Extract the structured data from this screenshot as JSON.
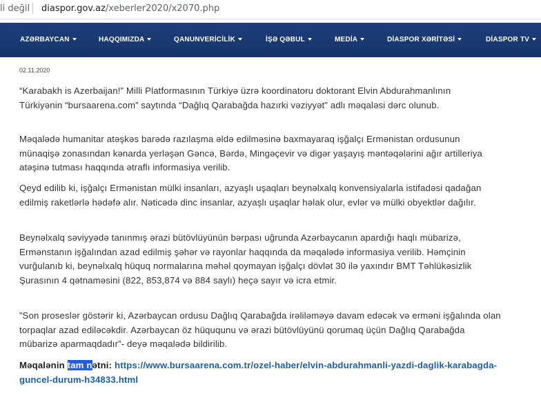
{
  "browser": {
    "security_text": "li değil",
    "url_domain": "diaspor.gov.az",
    "url_path": "/xeberler2020/x2070.php"
  },
  "nav": {
    "items": [
      {
        "label": "AZƏRBAYCAN"
      },
      {
        "label": "HAQQIMIZDA"
      },
      {
        "label": "QANUNVERİCİLİK"
      },
      {
        "label": "İŞƏ QƏBUL"
      },
      {
        "label": "MEDİA"
      },
      {
        "label": "DİASPOR XƏRİTƏSİ"
      },
      {
        "label": "DİASPOR TV"
      }
    ]
  },
  "article": {
    "date": "02.11.2020",
    "paragraphs": [
      "“Karabakh is Azerbaijan!” Milli Platformasının Türkiyə üzrə koordinatoru doktorant Elvin Abdurahmanlının Türkiyənin “bursaarena.com” saytında “Dağlıq Qarabağda hazırki vəziyyət” adlı məqaləsi dərc olunub.",
      "Məqalədə humanitar atəşkəs barədə razılaşma əldə edilməsinə baxmayaraq işğalçı Ermənistan ordusunun münaqişə zonasından kənarda yerləşən Gəncə, Bərdə, Mingəçevir və digər yaşayış məntəqələrini ağır artilleriya atəşinə tutması haqqında ətraflı informasiya verilib.",
      "Qeyd edilib ki, işğalçı Ermənistan mülki insanları, azyaşlı uşaqları beynəlxalq konvensiyalarla istifadəsi qadağan edilmiş raketlərlə hədəfə alır. Nəticədə dinc insanlar, azyaşlı uşaqlar həlak olur, evlər və mülki obyektlər dağılır.",
      "Beynəlxalq səviyyədə tanınmış ərazi bütövlüyünün bərpası uğrunda Azərbaycanın apardığı haqlı mübarizə, Ermənstanın işğalından azad edilmiş şəhər və rayonlar haqqında da məqalədə informasiya verilib. Həmçinin vurğulanıb ki, beynəlxalq hüquq normalarına məhəl qoymayan işğalçı dövlət 30 ilə yaxındır BMT Təhlükəsizlik Şurasının 4 qətnaməsini (822, 853,874 və 884 saylı) heçə sayır və icra etmir.",
      "”Son proseslər göstərir ki, Azərbaycan ordusu Dağlıq Qarabağda irəliləməyə davam edəcək və erməni işğalında olan torpaqlar azad ediləcəkdir. Azərbaycan öz hüququnu və ərazi bütövlüyünü qorumaq üçün Dağlıq Qarabağda mübarizə aparmaqdadır”- deyə məqalədə bildirilib."
    ],
    "source": {
      "label_pre": "Məqalənin ",
      "label_highlight": "tam n",
      "label_post": "ətni:",
      "link": "https://www.bursaarena.com.tr/ozel-haber/elvin-abdurahmanli-yazdi-daglik-karabagda-guncel-durum-h34833.html"
    }
  },
  "colors": {
    "nav_bg": "#1e3f7a",
    "link": "#1a5fa8",
    "selection": "#2a5bd7"
  }
}
